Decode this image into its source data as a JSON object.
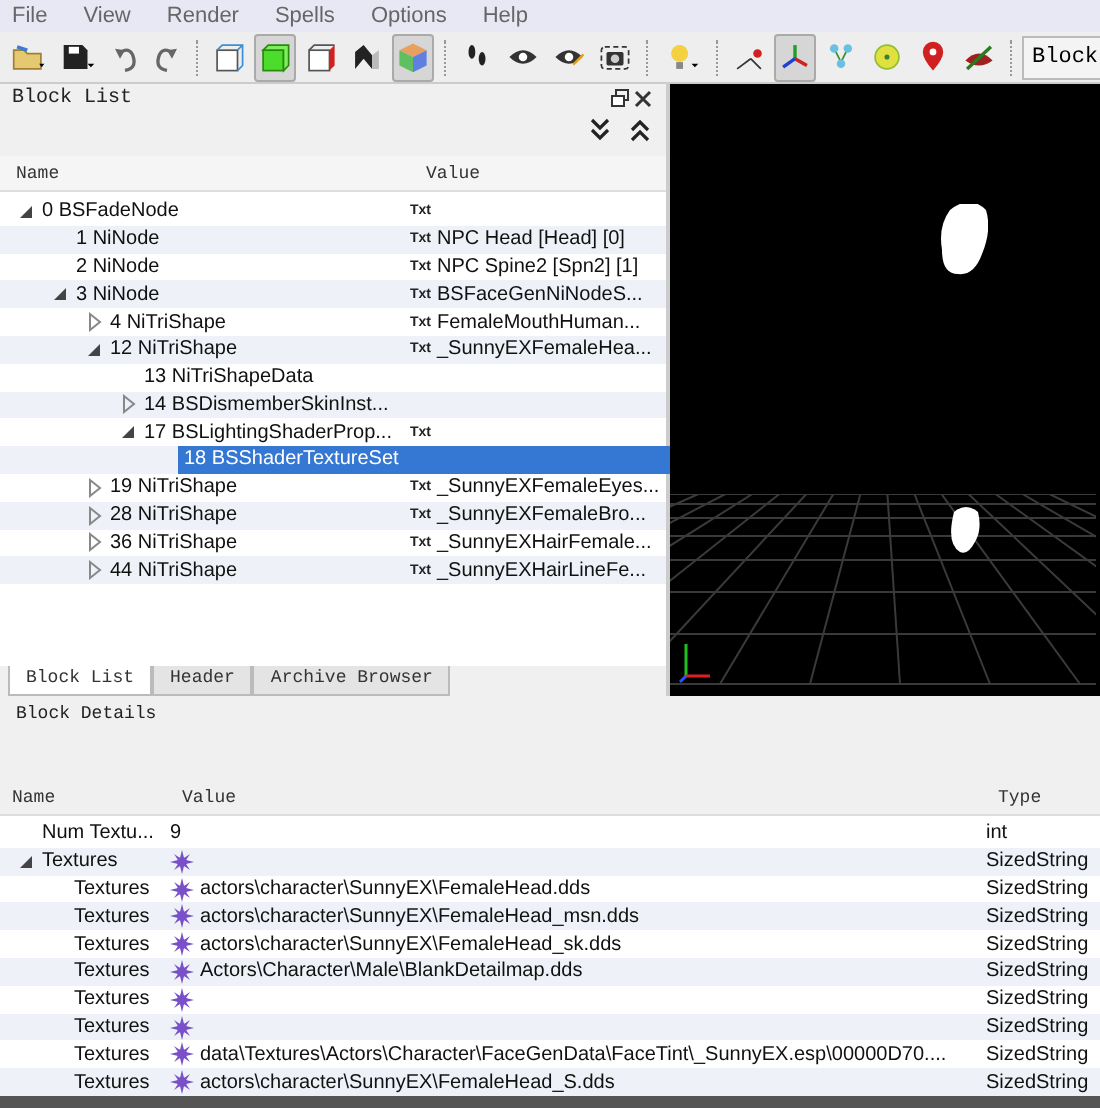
{
  "menu": [
    {
      "label": "File"
    },
    {
      "label": "View"
    },
    {
      "label": "Render"
    },
    {
      "label": "Spells"
    },
    {
      "label": "Options"
    },
    {
      "label": "Help"
    }
  ],
  "toolbar": {
    "items": [
      {
        "kind": "open",
        "pressed": false
      },
      {
        "kind": "save",
        "pressed": false
      },
      {
        "kind": "undo",
        "pressed": false
      },
      {
        "kind": "redo",
        "pressed": false
      },
      {
        "kind": "sep"
      },
      {
        "kind": "wire-cube",
        "pressed": false
      },
      {
        "kind": "solid-cube",
        "pressed": true
      },
      {
        "kind": "red-cube",
        "pressed": false
      },
      {
        "kind": "shape",
        "pressed": false
      },
      {
        "kind": "tex-cube",
        "pressed": true
      },
      {
        "kind": "sep"
      },
      {
        "kind": "footprints",
        "pressed": false
      },
      {
        "kind": "eye",
        "pressed": false
      },
      {
        "kind": "eye-edit",
        "pressed": false
      },
      {
        "kind": "camera",
        "pressed": false
      },
      {
        "kind": "sep"
      },
      {
        "kind": "bulb",
        "pressed": false
      },
      {
        "kind": "sep"
      },
      {
        "kind": "vertex",
        "pressed": false
      },
      {
        "kind": "axes",
        "pressed": true
      },
      {
        "kind": "nodes",
        "pressed": false
      },
      {
        "kind": "disc",
        "pressed": false
      },
      {
        "kind": "pin",
        "pressed": false
      },
      {
        "kind": "hidden",
        "pressed": false
      },
      {
        "kind": "sep"
      }
    ],
    "button": "Block"
  },
  "block_list": {
    "title": "Block List",
    "columns": [
      "Name",
      "Value"
    ],
    "tree": [
      {
        "label": "0 BSFadeNode",
        "tag": "Txt",
        "selected": false,
        "expanded": true,
        "children": [
          {
            "label": "1 NiNode",
            "tag": "Txt",
            "value": "NPC Head [Head] [0]",
            "selected": false
          },
          {
            "label": "2 NiNode",
            "tag": "Txt",
            "value": "NPC Spine2 [Spn2] [1]",
            "selected": false
          },
          {
            "label": "3 NiNode",
            "tag": "Txt",
            "value": "BSFaceGenNiNodeS...",
            "selected": false,
            "expanded": true,
            "children": [
              {
                "label": "4 NiTriShape",
                "tag": "Txt",
                "value": "FemaleMouthHuman...",
                "selected": false,
                "expanded": false
              },
              {
                "label": "12 NiTriShape",
                "tag": "Txt",
                "value": "_SunnyEXFemaleHea...",
                "selected": false,
                "expanded": true,
                "children": [
                  {
                    "label": "13 NiTriShapeData",
                    "selected": false
                  },
                  {
                    "label": "14 BSDismemberSkinInst...",
                    "selected": false,
                    "expanded": false
                  },
                  {
                    "label": "17 BSLightingShaderProp...",
                    "tag": "Txt",
                    "selected": false,
                    "expanded": true,
                    "children": [
                      {
                        "label": "18 BSShaderTextureSet",
                        "selected": true
                      }
                    ]
                  }
                ]
              },
              {
                "label": "19 NiTriShape",
                "tag": "Txt",
                "value": "_SunnyEXFemaleEyes...",
                "selected": false,
                "expanded": false
              },
              {
                "label": "28 NiTriShape",
                "tag": "Txt",
                "value": "_SunnyEXFemaleBro...",
                "selected": false,
                "expanded": false
              },
              {
                "label": "36 NiTriShape",
                "tag": "Txt",
                "value": "_SunnyEXHairFemale...",
                "selected": false,
                "expanded": false
              },
              {
                "label": "44 NiTriShape",
                "tag": "Txt",
                "value": "_SunnyEXHairLineFe...",
                "selected": false,
                "expanded": false
              }
            ]
          }
        ]
      }
    ],
    "tabs": [
      {
        "label": "Block List",
        "selected": true
      },
      {
        "label": "Header",
        "selected": false
      },
      {
        "label": "Archive Browser",
        "selected": false
      }
    ]
  },
  "block_details": {
    "title": "Block Details",
    "columns": [
      "Name",
      "Value",
      "Type"
    ],
    "rows": [
      {
        "name": "Num Textu...",
        "value": "9",
        "type": "int",
        "kind": "number"
      },
      {
        "name": "Textures",
        "type": "SizedString",
        "kind": "string",
        "expanded": true,
        "children": [
          {
            "name": "Textures",
            "value": "actors\\character\\SunnyEX\\FemaleHead.dds",
            "type": "SizedString",
            "kind": "string"
          },
          {
            "name": "Textures",
            "value": "actors\\character\\SunnyEX\\FemaleHead_msn.dds",
            "type": "SizedString",
            "kind": "string"
          },
          {
            "name": "Textures",
            "value": "actors\\character\\SunnyEX\\FemaleHead_sk.dds",
            "type": "SizedString",
            "kind": "string"
          },
          {
            "name": "Textures",
            "value": "Actors\\Character\\Male\\BlankDetailmap.dds",
            "type": "SizedString",
            "kind": "string"
          },
          {
            "name": "Textures",
            "type": "SizedString",
            "kind": "string"
          },
          {
            "name": "Textures",
            "type": "SizedString",
            "kind": "string"
          },
          {
            "name": "Textures",
            "value": "data\\Textures\\Actors\\Character\\FaceGenData\\FaceTint\\_SunnyEX.esp\\00000D70....",
            "type": "SizedString",
            "kind": "string"
          },
          {
            "name": "Textures",
            "value": "actors\\character\\SunnyEX\\FemaleHead_S.dds",
            "type": "SizedString",
            "kind": "string"
          }
        ]
      }
    ]
  }
}
